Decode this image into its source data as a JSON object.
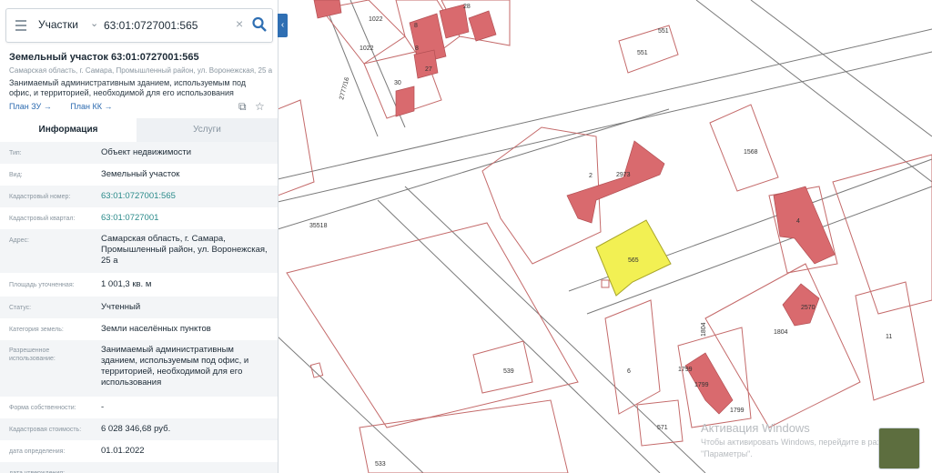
{
  "search": {
    "layer_label": "Участки",
    "query": "63:01:0727001:565"
  },
  "object": {
    "title": "Земельный участок 63:01:0727001:565",
    "address_short": "Самарская область, г. Самара, Промышленный район, ул. Воронежская, 25 а",
    "description": "Занимаемый административным зданием, используемым под офис, и территорией, необходимой для его использования",
    "link_zu": "План ЗУ →",
    "link_kk": "План КК →"
  },
  "tabs": [
    {
      "label": "Информация",
      "active": true
    },
    {
      "label": "Услуги",
      "active": false
    }
  ],
  "info_rows": [
    {
      "key": "Тип:",
      "value": "Объект недвижимости"
    },
    {
      "key": "Вид:",
      "value": "Земельный участок"
    },
    {
      "key": "Кадастровый номер:",
      "value": "63:01:0727001:565"
    },
    {
      "key": "Кадастровый квартал:",
      "value": "63:01:0727001"
    },
    {
      "key": "Адрес:",
      "value": "Самарская область, г. Самара, Промышленный район, ул. Воронежская, 25 а"
    },
    {
      "key": "Площадь уточненная:",
      "value": "1 001,3 кв. м"
    },
    {
      "key": "Статус:",
      "value": "Учтенный"
    },
    {
      "key": "Категория земель:",
      "value": "Земли населённых пунктов"
    },
    {
      "key": "Разрешенное использование:",
      "value": "Занимаемый административным зданием, используемым под офис, и территорией, необходимой для его использования"
    },
    {
      "key": "Форма собственности:",
      "value": "-"
    },
    {
      "key": "Кадастровая стоимость:",
      "value": "6 028 346,68 руб."
    },
    {
      "key": "дата определения:",
      "value": "01.01.2022"
    },
    {
      "key": "дата утверждения:",
      "value": ""
    }
  ],
  "map": {
    "labels": [
      "1022",
      "1022",
      "8",
      "8",
      "28",
      "27",
      "30",
      "551",
      "551",
      "2777/16",
      "35518",
      "2",
      "2973",
      "565",
      "1568",
      "4",
      "1804",
      "1804",
      "2570",
      "11",
      "539",
      "6",
      "1799",
      "1799",
      "1799",
      "571",
      "533"
    ],
    "highlight_color": "#f2f053",
    "building_color": "#d96a6e",
    "parcel_line_color": "#c46a6a",
    "road_line_color": "#7a7a7a"
  },
  "watermark": {
    "line1": "Активация Windows",
    "line2": "Чтобы активировать Windows, перейдите в раздел",
    "line3": "\"Параметры\"."
  },
  "icons": [
    "menu-icon",
    "chevron-down-icon",
    "clear-icon",
    "search-icon",
    "collapse-icon",
    "copy-icon",
    "star-icon",
    "layers-thumbnail"
  ]
}
